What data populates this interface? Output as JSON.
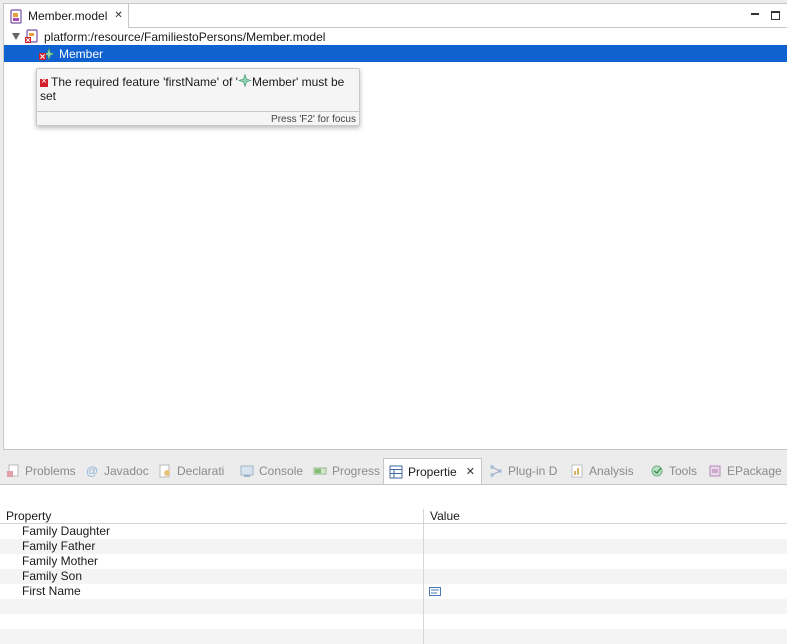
{
  "editor": {
    "tab_label": "Member.model",
    "tree": {
      "root_label": "platform:/resource/FamiliestoPersons/Member.model",
      "child_label": "Member"
    },
    "tooltip": {
      "message_part1": "The required feature 'firstName' of '",
      "message_part2": "Member' must be set",
      "footer": "Press 'F2' for focus"
    }
  },
  "views": {
    "tabs": [
      {
        "label": "Problems",
        "icon": "problems-icon"
      },
      {
        "label": "Javadoc",
        "icon": "javadoc-icon"
      },
      {
        "label": "Declarati",
        "icon": "declaration-icon"
      },
      {
        "label": "Console",
        "icon": "console-icon"
      },
      {
        "label": "Progress",
        "icon": "progress-icon"
      },
      {
        "label": "Propertie",
        "icon": "properties-icon"
      },
      {
        "label": "Plug-in D",
        "icon": "plugin-dependencies-icon"
      },
      {
        "label": "Analysis",
        "icon": "analysis-icon"
      },
      {
        "label": "Tools",
        "icon": "tools-icon"
      },
      {
        "label": "EPackage",
        "icon": "epackage-icon"
      }
    ]
  },
  "properties": {
    "col_property": "Property",
    "col_value": "Value",
    "rows": [
      {
        "property": "Family Daughter",
        "value": ""
      },
      {
        "property": "Family Father",
        "value": ""
      },
      {
        "property": "Family Mother",
        "value": ""
      },
      {
        "property": "Family Son",
        "value": ""
      },
      {
        "property": "First Name",
        "value": ""
      }
    ]
  },
  "colors": {
    "selection": "#1062d1",
    "error": "#d21f2a"
  }
}
